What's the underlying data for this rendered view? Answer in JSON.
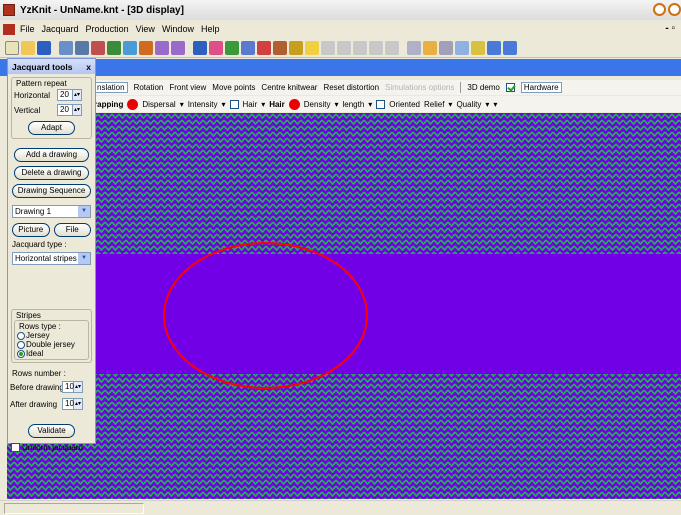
{
  "window": {
    "title": "YzKnit - UnName.knt - [3D display]",
    "mdi_controls": "- ̅θ"
  },
  "menubar": {
    "items": [
      "File",
      "Jacquard",
      "Production",
      "View",
      "Window",
      "Help"
    ]
  },
  "toolbar": {
    "icons": [
      "new-icon",
      "open-icon",
      "save-icon",
      "preview-icon",
      "print-icon",
      "edit-icon",
      "grid-icon",
      "jacquard-icon",
      "measure-icon",
      "zoom-icon",
      "zoom-out-icon",
      "save-as-icon",
      "color-icon",
      "pattern-icon",
      "shape-icon",
      "pen-icon",
      "help-icon"
    ]
  },
  "view_tabs": {
    "items": [
      {
        "label": "nslation",
        "active": true
      },
      {
        "label": "Rotation",
        "active": false
      },
      {
        "label": "Front view",
        "active": false
      },
      {
        "label": "Move points",
        "active": false
      },
      {
        "label": "Centre knitwear",
        "active": false
      },
      {
        "label": "Reset distortion",
        "active": false
      },
      {
        "label": "Simulations options",
        "active": false,
        "disabled": true
      },
      {
        "label": "3D demo",
        "active": false
      }
    ],
    "hardware_label": "Hardware",
    "hardware_checked": true
  },
  "render_options": {
    "wrapping_label": "rapping",
    "dispersal_label": "Dispersal",
    "intensity_label": "Intensity",
    "hair_label": "Hair",
    "hair_bold_label": "Hair",
    "density_label": "Density",
    "length_label": "length",
    "oriented_label": "Oriented",
    "relief_label": "Relief",
    "quality_label": "Quality",
    "dot_color": "#ea0000"
  },
  "panel": {
    "title": "Jacquard tools",
    "close": "x",
    "pattern_repeat": {
      "legend": "Pattern repeat",
      "horizontal_label": "Horizontal",
      "horizontal_value": "20",
      "vertical_label": "Vertical",
      "vertical_value": "20",
      "adapt_label": "Adapt"
    },
    "add_drawing_label": "Add a drawing",
    "delete_drawing_label": "Delete a drawing",
    "sequence_label": "Drawing Sequence",
    "drawing_select_value": "Drawing 1",
    "picture_label": "Picture",
    "file_label": "File",
    "jacquard_type_label": "Jacquard type :",
    "jacquard_type_value": "Horizontal stripes",
    "stripes": {
      "legend": "Stripes",
      "rows_type_label": "Rows type :",
      "options": [
        {
          "label": "Jersey",
          "selected": false
        },
        {
          "label": "Double jersey",
          "selected": false
        },
        {
          "label": "Ideal",
          "selected": true
        }
      ],
      "rows_number_label": "Rows number :",
      "before_label": "Before drawing",
      "before_value": "10",
      "after_label": "After drawing",
      "after_value": "10",
      "validate_label": "Validate"
    },
    "uniform_label": "Uniform jacquard",
    "uniform_checked": false
  },
  "colors": {
    "knit_purple": "#7200e6",
    "knit_green": "#1fb84a",
    "annotation": "#ff0000",
    "header_blue": "#3b76e8"
  }
}
